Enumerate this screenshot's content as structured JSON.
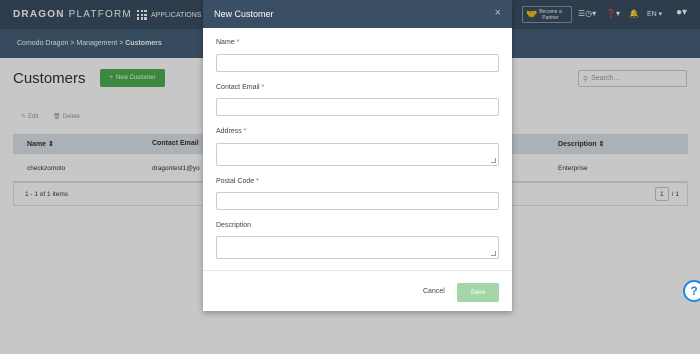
{
  "topbar": {
    "brand_bold": "DRAGON",
    "brand_rest": " PLATFORM",
    "apps_label": "APPLICATIONS",
    "partner_line1": "Become a",
    "partner_line2": "Partner",
    "lang": "EN",
    "icons": [
      "apps-grid-icon",
      "handshake-icon",
      "clock-icon",
      "help-icon",
      "notification-bell-icon",
      "user-avatar-icon"
    ]
  },
  "breadcrumb": {
    "items": [
      "Comodo Dragon",
      "Management"
    ],
    "sep": ">",
    "current": "Customers"
  },
  "page": {
    "title": "Customers",
    "new_button": "New Customer",
    "search_placeholder": "Search...",
    "edit_label": "Edit",
    "delete_label": "Delete"
  },
  "table": {
    "columns": [
      "Name ⇕",
      "Contact Email",
      "Description ⇕"
    ],
    "rows": [
      {
        "name": "checkzomoto",
        "email": "dragontest1@yo",
        "description": "Enterprise"
      }
    ],
    "count": "1 - 1 of 1 items",
    "page": "1",
    "page_total": "/ 1"
  },
  "modal": {
    "title": "New Customer",
    "close": "×",
    "fields": [
      {
        "label": "Name",
        "required": "*"
      },
      {
        "label": "Contact Email",
        "required": "*"
      },
      {
        "label": "Address",
        "required": "*"
      },
      {
        "label": "Postal Code",
        "required": "*"
      },
      {
        "label": "Description",
        "required": ""
      }
    ],
    "cancel": "Cancel",
    "save": "Save"
  },
  "help": {
    "label": "?"
  },
  "colors": {
    "topbar": "#3a4f63",
    "crumbbar": "#47617a",
    "primary_green": "#4caf50",
    "save_disabled": "#a5d6a7",
    "required": "#d9534f",
    "help_blue": "#1e88e5"
  }
}
